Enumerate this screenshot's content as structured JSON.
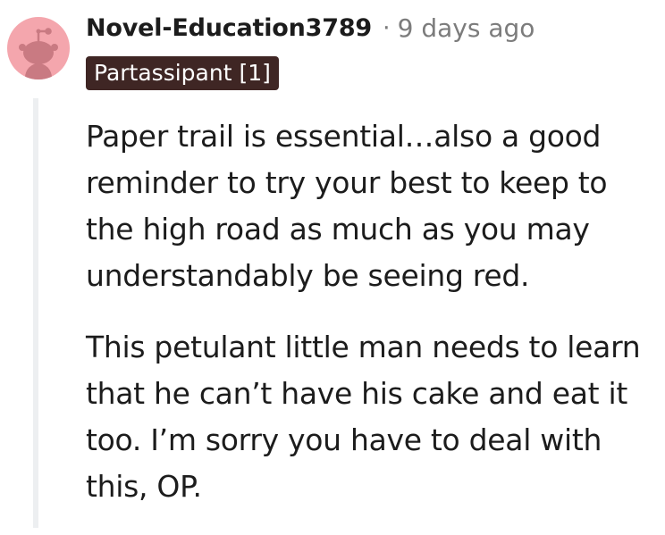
{
  "comment": {
    "author": "Novel-Education3789",
    "separator": "·",
    "timestamp": "9 days ago",
    "flair": "Partassipant [1]",
    "paragraphs": [
      "Paper trail is essential…also a good reminder to try your best to keep to the high road as much as you may understandably be seeing red.",
      "This petulant little man needs to learn that he can’t have his cake and eat it too. I’m sorry you have to deal with this, OP."
    ]
  },
  "avatar": {
    "icon": "snoo-avatar-icon",
    "background_color": "#f4a6ad",
    "figure_color": "#c97a82"
  },
  "colors": {
    "flair_background": "#3f2624",
    "thread_line": "#edeff1",
    "meta_text": "#7c7c7c"
  }
}
